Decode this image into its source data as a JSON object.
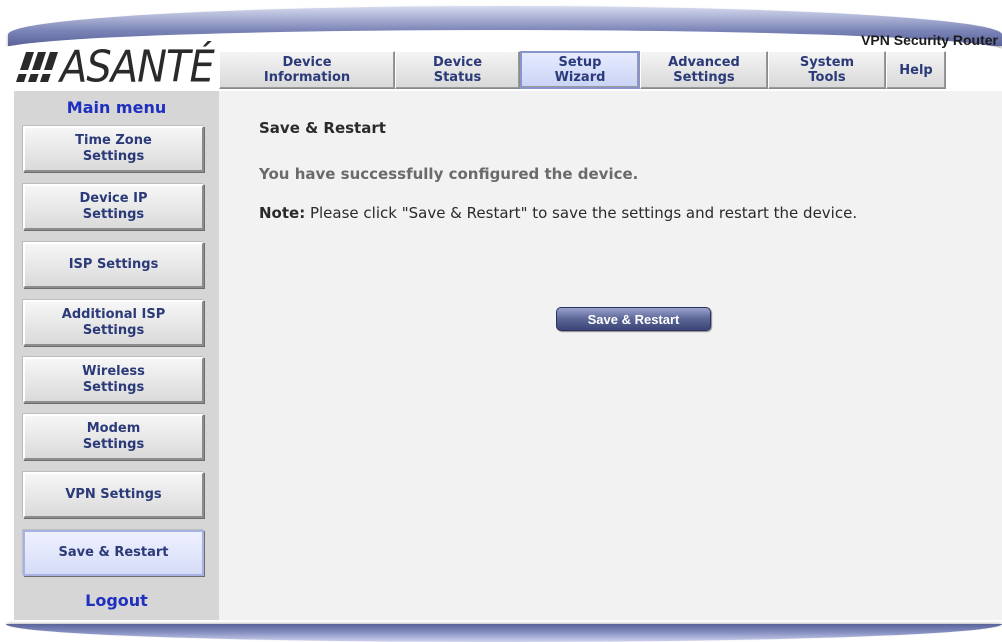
{
  "brand": {
    "logo_text": "ASANTÉ",
    "product": "VPN Security Router"
  },
  "tabs": [
    {
      "label": "Device\nInformation"
    },
    {
      "label": "Device\nStatus"
    },
    {
      "label": "Setup\nWizard"
    },
    {
      "label": "Advanced\nSettings"
    },
    {
      "label": "System\nTools"
    },
    {
      "label": "Help"
    }
  ],
  "sidebar": {
    "title": "Main menu",
    "items": [
      {
        "label": "Time Zone\nSettings"
      },
      {
        "label": "Device IP\nSettings"
      },
      {
        "label": "ISP Settings"
      },
      {
        "label": "Additional ISP\nSettings"
      },
      {
        "label": "Wireless\nSettings"
      },
      {
        "label": "Modem\nSettings"
      },
      {
        "label": "VPN Settings"
      },
      {
        "label": "Save & Restart"
      }
    ],
    "logout": "Logout"
  },
  "main": {
    "title": "Save & Restart",
    "success": "You have successfully configured the device.",
    "note_label": "Note:",
    "note_text": " Please click \"Save & Restart\" to save the settings and restart the device.",
    "button": "Save & Restart"
  },
  "colors": {
    "accent": "#1f2fbf",
    "tab_text": "#2b3a78",
    "button": "#4a5487"
  }
}
